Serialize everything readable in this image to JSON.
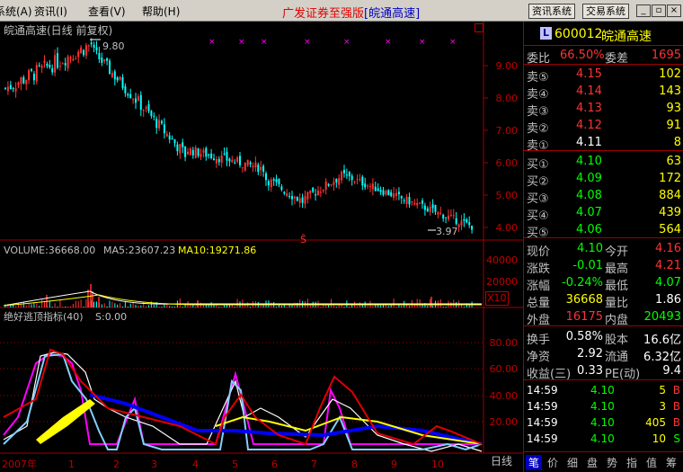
{
  "menu": {
    "items": [
      "系统(A)",
      "资讯(I)",
      "查看(V)",
      "帮助(H)"
    ]
  },
  "app": {
    "title": "广发证券至强版",
    "subtitle": "[皖通高速]",
    "btn_info": "资讯系统",
    "btn_trade": "交易系统"
  },
  "chart": {
    "title": "皖通高速(日线 前复权)",
    "high_marker": "9.80",
    "low_marker": "3.97",
    "price_axis": [
      "9.00",
      "8.00",
      "7.00",
      "6.00",
      "5.00",
      "4.00"
    ],
    "volume_label": "VOLUME:36668.00",
    "ma5_label": "MA5:23607.23",
    "ma10_label": "MA10:19271.86",
    "vol_axis": [
      "40000",
      "20000"
    ],
    "vol_unit": "X10",
    "indicator_label": "绝好逃顶指标(40)",
    "indicator_value": "S:0.00",
    "ind_axis": [
      "80.00",
      "60.00",
      "40.00",
      "20.00"
    ],
    "date_labels": [
      "2007年",
      "1",
      "2",
      "3",
      "4",
      "5",
      "6",
      "7",
      "8",
      "9",
      "10"
    ],
    "day_line_btn": "日线",
    "colors": {
      "up": "#ff3232",
      "down": "#00ffff",
      "ma5": "#ffffff",
      "ma10": "#ffff00",
      "ind1": "#ff00ff",
      "ind2": "#ffffff",
      "ind3": "#80d0ff",
      "ind4": "#ffff00",
      "ind5": "#0000ff",
      "ind6": "#e00000"
    }
  },
  "quote": {
    "code": "600012",
    "name": "皖通高速",
    "ratio_label": "委比",
    "ratio": "66.50%",
    "diff_label": "委差",
    "diff": "1695",
    "sells": [
      {
        "label": "卖⑤",
        "price": "4.15",
        "vol": "102"
      },
      {
        "label": "卖④",
        "price": "4.14",
        "vol": "143"
      },
      {
        "label": "卖③",
        "price": "4.13",
        "vol": "93"
      },
      {
        "label": "卖②",
        "price": "4.12",
        "vol": "91"
      },
      {
        "label": "卖①",
        "price": "4.11",
        "vol": "8"
      }
    ],
    "buys": [
      {
        "label": "买①",
        "price": "4.10",
        "vol": "63"
      },
      {
        "label": "买②",
        "price": "4.09",
        "vol": "172"
      },
      {
        "label": "买③",
        "price": "4.08",
        "vol": "884"
      },
      {
        "label": "买④",
        "price": "4.07",
        "vol": "439"
      },
      {
        "label": "买⑤",
        "price": "4.06",
        "vol": "564"
      }
    ],
    "stats": [
      {
        "l1": "现价",
        "v1": "4.10",
        "l2": "今开",
        "v2": "4.16"
      },
      {
        "l1": "涨跌",
        "v1": "-0.01",
        "l2": "最高",
        "v2": "4.21"
      },
      {
        "l1": "涨幅",
        "v1": "-0.24%",
        "l2": "最低",
        "v2": "4.07"
      },
      {
        "l1": "总量",
        "v1": "36668",
        "l2": "量比",
        "v2": "1.86"
      },
      {
        "l1": "外盘",
        "v1": "16175",
        "l2": "内盘",
        "v2": "20493"
      }
    ],
    "fin": [
      {
        "l1": "换手",
        "v1": "0.58%",
        "l2": "股本",
        "v2": "16.6亿"
      },
      {
        "l1": "净资",
        "v1": "2.92",
        "l2": "流通",
        "v2": "6.32亿"
      },
      {
        "l1": "收益(三)",
        "v1": "0.33",
        "l2": "PE(动)",
        "v2": "9.4"
      }
    ],
    "ticks": [
      {
        "time": "14:59",
        "price": "4.10",
        "vol": "5",
        "side": "B"
      },
      {
        "time": "14:59",
        "price": "4.10",
        "vol": "3",
        "side": "B"
      },
      {
        "time": "14:59",
        "price": "4.10",
        "vol": "405",
        "side": "B"
      },
      {
        "time": "14:59",
        "price": "4.10",
        "vol": "10",
        "side": "S"
      }
    ],
    "tabs": [
      "笔",
      "价",
      "细",
      "盘",
      "势",
      "指",
      "值",
      "筹"
    ]
  }
}
